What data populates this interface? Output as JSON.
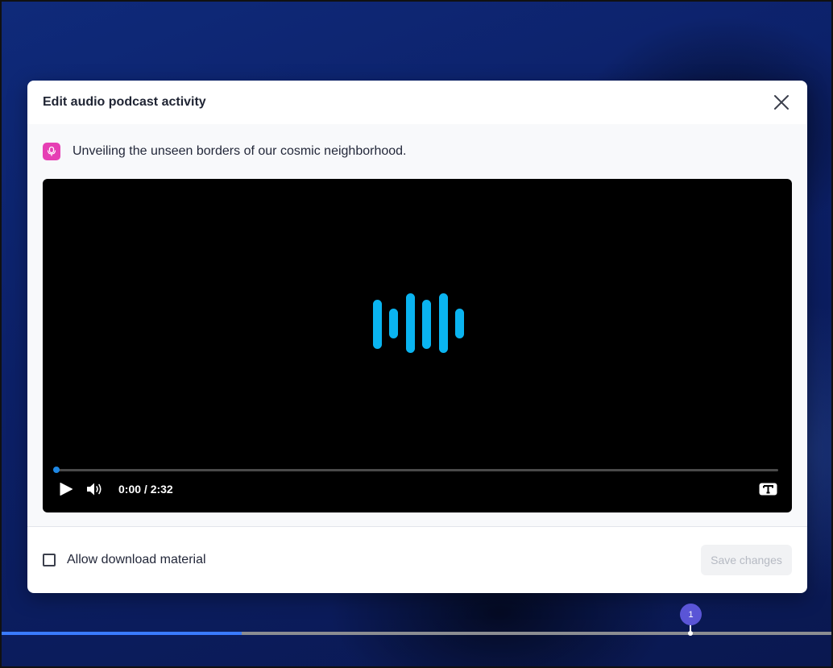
{
  "dialog": {
    "title": "Edit audio podcast activity",
    "close_icon": "close-icon"
  },
  "activity": {
    "icon": "podcast-microphone-icon",
    "title": "Unveiling the unseen borders of our cosmic neighborhood."
  },
  "player": {
    "visual": "audio-waveform-icon",
    "accent_color": "#0ab4f0",
    "progress": 0,
    "time": "0:00 / 2:32",
    "controls": [
      "play-icon",
      "volume-icon",
      "captions-icon"
    ]
  },
  "footer": {
    "allow_download_label": "Allow download material",
    "allow_download_checked": false,
    "save_label": "Save changes"
  },
  "timeline": {
    "progress_fraction": 0.29,
    "marker_label": "1"
  }
}
